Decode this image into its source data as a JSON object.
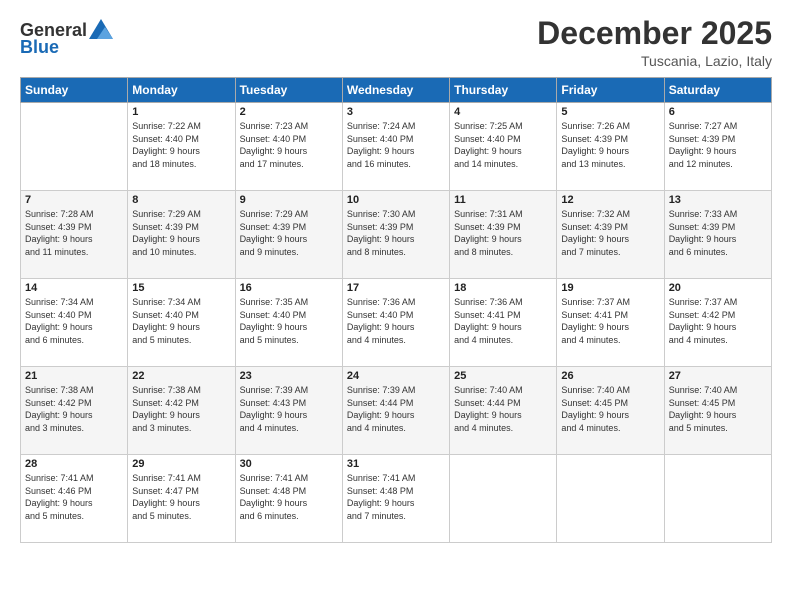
{
  "logo": {
    "general": "General",
    "blue": "Blue"
  },
  "title": "December 2025",
  "subtitle": "Tuscania, Lazio, Italy",
  "days_of_week": [
    "Sunday",
    "Monday",
    "Tuesday",
    "Wednesday",
    "Thursday",
    "Friday",
    "Saturday"
  ],
  "weeks": [
    [
      {
        "day": "",
        "content": ""
      },
      {
        "day": "1",
        "content": "Sunrise: 7:22 AM\nSunset: 4:40 PM\nDaylight: 9 hours\nand 18 minutes."
      },
      {
        "day": "2",
        "content": "Sunrise: 7:23 AM\nSunset: 4:40 PM\nDaylight: 9 hours\nand 17 minutes."
      },
      {
        "day": "3",
        "content": "Sunrise: 7:24 AM\nSunset: 4:40 PM\nDaylight: 9 hours\nand 16 minutes."
      },
      {
        "day": "4",
        "content": "Sunrise: 7:25 AM\nSunset: 4:40 PM\nDaylight: 9 hours\nand 14 minutes."
      },
      {
        "day": "5",
        "content": "Sunrise: 7:26 AM\nSunset: 4:39 PM\nDaylight: 9 hours\nand 13 minutes."
      },
      {
        "day": "6",
        "content": "Sunrise: 7:27 AM\nSunset: 4:39 PM\nDaylight: 9 hours\nand 12 minutes."
      }
    ],
    [
      {
        "day": "7",
        "content": "Sunrise: 7:28 AM\nSunset: 4:39 PM\nDaylight: 9 hours\nand 11 minutes."
      },
      {
        "day": "8",
        "content": "Sunrise: 7:29 AM\nSunset: 4:39 PM\nDaylight: 9 hours\nand 10 minutes."
      },
      {
        "day": "9",
        "content": "Sunrise: 7:29 AM\nSunset: 4:39 PM\nDaylight: 9 hours\nand 9 minutes."
      },
      {
        "day": "10",
        "content": "Sunrise: 7:30 AM\nSunset: 4:39 PM\nDaylight: 9 hours\nand 8 minutes."
      },
      {
        "day": "11",
        "content": "Sunrise: 7:31 AM\nSunset: 4:39 PM\nDaylight: 9 hours\nand 8 minutes."
      },
      {
        "day": "12",
        "content": "Sunrise: 7:32 AM\nSunset: 4:39 PM\nDaylight: 9 hours\nand 7 minutes."
      },
      {
        "day": "13",
        "content": "Sunrise: 7:33 AM\nSunset: 4:39 PM\nDaylight: 9 hours\nand 6 minutes."
      }
    ],
    [
      {
        "day": "14",
        "content": "Sunrise: 7:34 AM\nSunset: 4:40 PM\nDaylight: 9 hours\nand 6 minutes."
      },
      {
        "day": "15",
        "content": "Sunrise: 7:34 AM\nSunset: 4:40 PM\nDaylight: 9 hours\nand 5 minutes."
      },
      {
        "day": "16",
        "content": "Sunrise: 7:35 AM\nSunset: 4:40 PM\nDaylight: 9 hours\nand 5 minutes."
      },
      {
        "day": "17",
        "content": "Sunrise: 7:36 AM\nSunset: 4:40 PM\nDaylight: 9 hours\nand 4 minutes."
      },
      {
        "day": "18",
        "content": "Sunrise: 7:36 AM\nSunset: 4:41 PM\nDaylight: 9 hours\nand 4 minutes."
      },
      {
        "day": "19",
        "content": "Sunrise: 7:37 AM\nSunset: 4:41 PM\nDaylight: 9 hours\nand 4 minutes."
      },
      {
        "day": "20",
        "content": "Sunrise: 7:37 AM\nSunset: 4:42 PM\nDaylight: 9 hours\nand 4 minutes."
      }
    ],
    [
      {
        "day": "21",
        "content": "Sunrise: 7:38 AM\nSunset: 4:42 PM\nDaylight: 9 hours\nand 3 minutes."
      },
      {
        "day": "22",
        "content": "Sunrise: 7:38 AM\nSunset: 4:42 PM\nDaylight: 9 hours\nand 3 minutes."
      },
      {
        "day": "23",
        "content": "Sunrise: 7:39 AM\nSunset: 4:43 PM\nDaylight: 9 hours\nand 4 minutes."
      },
      {
        "day": "24",
        "content": "Sunrise: 7:39 AM\nSunset: 4:44 PM\nDaylight: 9 hours\nand 4 minutes."
      },
      {
        "day": "25",
        "content": "Sunrise: 7:40 AM\nSunset: 4:44 PM\nDaylight: 9 hours\nand 4 minutes."
      },
      {
        "day": "26",
        "content": "Sunrise: 7:40 AM\nSunset: 4:45 PM\nDaylight: 9 hours\nand 4 minutes."
      },
      {
        "day": "27",
        "content": "Sunrise: 7:40 AM\nSunset: 4:45 PM\nDaylight: 9 hours\nand 5 minutes."
      }
    ],
    [
      {
        "day": "28",
        "content": "Sunrise: 7:41 AM\nSunset: 4:46 PM\nDaylight: 9 hours\nand 5 minutes."
      },
      {
        "day": "29",
        "content": "Sunrise: 7:41 AM\nSunset: 4:47 PM\nDaylight: 9 hours\nand 5 minutes."
      },
      {
        "day": "30",
        "content": "Sunrise: 7:41 AM\nSunset: 4:48 PM\nDaylight: 9 hours\nand 6 minutes."
      },
      {
        "day": "31",
        "content": "Sunrise: 7:41 AM\nSunset: 4:48 PM\nDaylight: 9 hours\nand 7 minutes."
      },
      {
        "day": "",
        "content": ""
      },
      {
        "day": "",
        "content": ""
      },
      {
        "day": "",
        "content": ""
      }
    ]
  ]
}
